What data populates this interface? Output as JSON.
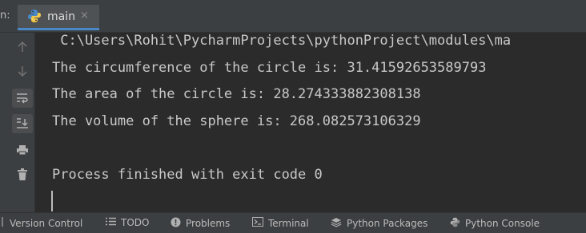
{
  "tabbar": {
    "run_label": "n:",
    "tab_title": "main",
    "tab_close": "×"
  },
  "gutter": {
    "buttons": [
      "up-arrow-icon",
      "down-arrow-icon",
      "soft-wrap-icon",
      "scroll-to-end-icon",
      "print-icon",
      "trash-icon"
    ]
  },
  "console": {
    "lines": [
      " C:\\Users\\Rohit\\PycharmProjects\\pythonProject\\modules\\ma",
      "The circumference of the circle is: 31.41592653589793",
      "The area of the circle is: 28.274333882308138",
      "The volume of the sphere is: 268.082573106329",
      "Process finished with exit code 0"
    ]
  },
  "bottombar": {
    "version_control": "Version Control",
    "todo": "TODO",
    "problems": "Problems",
    "terminal": "Terminal",
    "python_packages": "Python Packages",
    "python_console": "Python Console"
  },
  "colors": {
    "background": "#2b2b2b",
    "panel": "#3c3f41",
    "accent": "#4a88c7",
    "text": "#c8c8c8"
  }
}
